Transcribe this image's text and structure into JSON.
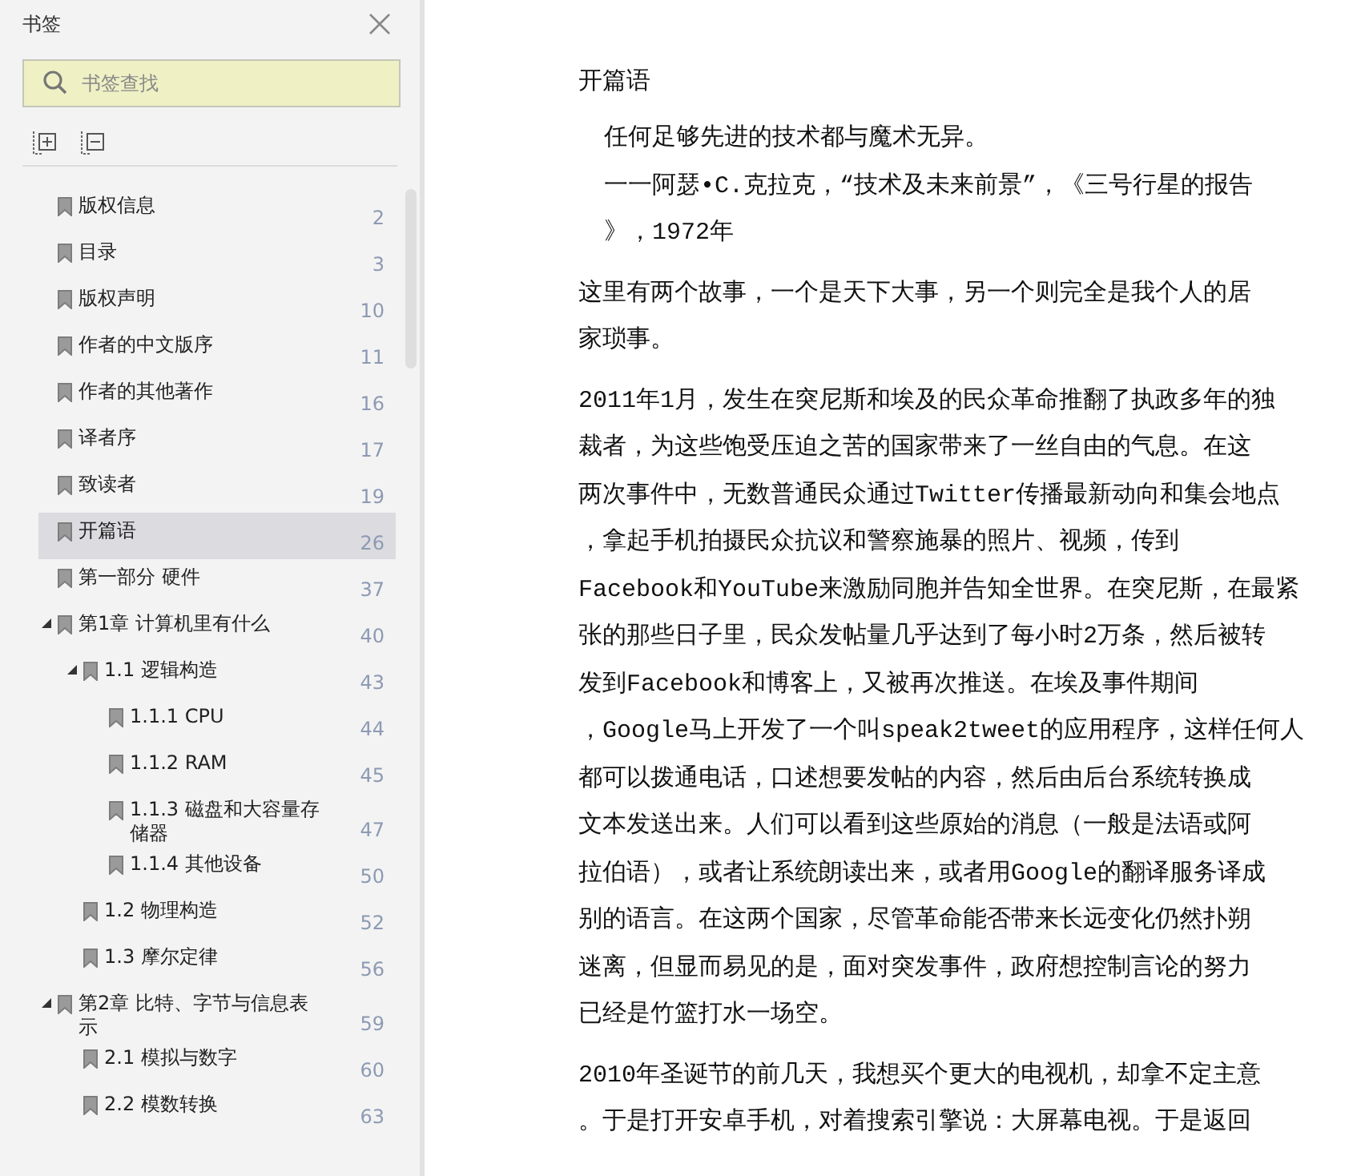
{
  "sidebar": {
    "title": "书签",
    "search": {
      "placeholder": "书签查找"
    },
    "items": [
      {
        "title": "版权信息",
        "page": "2",
        "selected": false
      },
      {
        "title": "目录",
        "page": "3",
        "selected": false
      },
      {
        "title": "版权声明",
        "page": "10",
        "selected": false
      },
      {
        "title": "作者的中文版序",
        "page": "11",
        "selected": false
      },
      {
        "title": "作者的其他著作",
        "page": "16",
        "selected": false
      },
      {
        "title": "译者序",
        "page": "17",
        "selected": false
      },
      {
        "title": "致读者",
        "page": "19",
        "selected": false
      },
      {
        "title": "开篇语",
        "page": "26",
        "selected": true
      },
      {
        "title": "第一部分 硬件",
        "page": "37",
        "selected": false
      },
      {
        "title": "第1章 计算机里有什么",
        "page": "40",
        "selected": false,
        "expanded": true,
        "children": [
          {
            "title": "1.1 逻辑构造",
            "page": "43",
            "selected": false,
            "expanded": true,
            "children": [
              {
                "title": "1.1.1 CPU",
                "page": "44",
                "selected": false
              },
              {
                "title": "1.1.2 RAM",
                "page": "45",
                "selected": false
              },
              {
                "title": "1.1.3 磁盘和大容量存储器",
                "page": "47",
                "selected": false
              },
              {
                "title": "1.1.4 其他设备",
                "page": "50",
                "selected": false
              }
            ]
          },
          {
            "title": "1.2 物理构造",
            "page": "52",
            "selected": false
          },
          {
            "title": "1.3 摩尔定律",
            "page": "56",
            "selected": false
          }
        ]
      },
      {
        "title": "第2章 比特、字节与信息表示",
        "page": "59",
        "selected": false,
        "expanded": true,
        "children": [
          {
            "title": "2.1 模拟与数字",
            "page": "60",
            "selected": false
          },
          {
            "title": "2.2 模数转换",
            "page": "63",
            "selected": false
          }
        ]
      }
    ]
  },
  "document": {
    "heading": "开篇语",
    "paragraphs": [
      {
        "kind": "quote",
        "lines": [
          "任何足够先进的技术都与魔术无异。",
          "一一阿瑟•C.克拉克，“技术及未来前景”，《三号行星的报告",
          "》，1972年"
        ]
      },
      {
        "kind": "body",
        "lines": [
          "这里有两个故事，一个是天下大事，另一个则完全是我个人的居",
          "家琐事。"
        ]
      },
      {
        "kind": "body",
        "lines": [
          "2011年1月，发生在突尼斯和埃及的民众革命推翻了执政多年的独",
          "裁者，为这些饱受压迫之苦的国家带来了一丝自由的气息。在这",
          "两次事件中，无数普通民众通过Twitter传播最新动向和集会地点",
          "，拿起手机拍摄民众抗议和警察施暴的照片、视频，传到",
          "Facebook和YouTube来激励同胞并告知全世界。在突尼斯，在最紧",
          "张的那些日子里，民众发帖量几乎达到了每小时2万条，然后被转",
          "发到Facebook和博客上，又被再次推送。在埃及事件期间",
          "，Google马上开发了一个叫speak2tweet的应用程序，这样任何人",
          "都可以拨通电话，口述想要发帖的内容，然后由后台系统转换成",
          "文本发送出来。人们可以看到这些原始的消息（一般是法语或阿",
          "拉伯语），或者让系统朗读出来，或者用Google的翻译服务译成",
          "别的语言。在这两个国家，尽管革命能否带来长远变化仍然扑朔",
          "迷离，但显而易见的是，面对突发事件，政府想控制言论的努力",
          "已经是竹篮打水一场空。"
        ]
      },
      {
        "kind": "body",
        "lines": [
          "2010年圣诞节的前几天，我想买个更大的电视机，却拿不定主意",
          "。于是打开安卓手机，对着搜索引擎说：大屏幕电视。于是返回"
        ]
      }
    ]
  }
}
